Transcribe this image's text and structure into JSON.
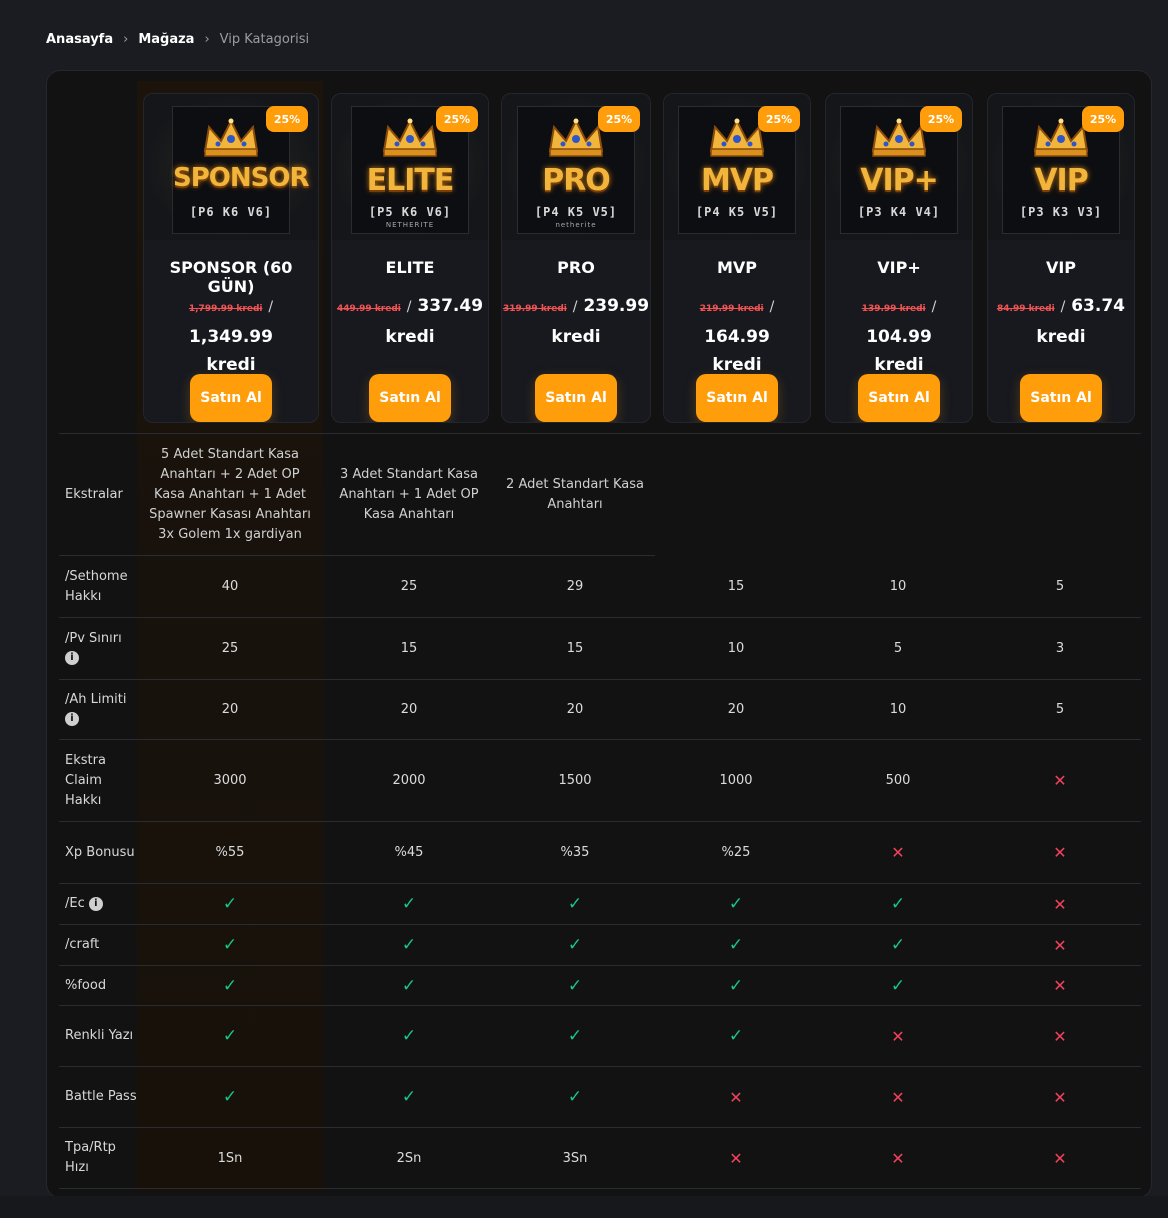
{
  "breadcrumb": [
    "Anasayfa",
    "Mağaza",
    "Vip Katagorisi"
  ],
  "colors": {
    "accent": "#ff9d0a",
    "check": "#17c78a",
    "cross": "#f0425b",
    "old_price": "#f25353"
  },
  "plans": [
    {
      "name": "SPONSOR (60 GÜN)",
      "logo": "SPONSOR",
      "logo_sub": "[P6 K6 V6]",
      "logo_tag": "",
      "badge": "25%",
      "old_price": "1,799.99 kredi",
      "price": "1,349.99",
      "currency": "kredi",
      "buy_label": "Satın Al"
    },
    {
      "name": "ELITE",
      "logo": "ELITE",
      "logo_sub": "[P5 K6 V6]",
      "logo_tag": "NETHERITE",
      "badge": "25%",
      "old_price": "449.99 kredi",
      "price": "337.49",
      "currency": "kredi",
      "buy_label": "Satın Al"
    },
    {
      "name": "PRO",
      "logo": "PRO",
      "logo_sub": "[P4 K5 V5]",
      "logo_tag": "netherite",
      "badge": "25%",
      "old_price": "319.99 kredi",
      "price": "239.99",
      "currency": "kredi",
      "buy_label": "Satın Al"
    },
    {
      "name": "MVP",
      "logo": "MVP",
      "logo_sub": "[P4 K5 V5]",
      "logo_tag": "",
      "badge": "25%",
      "old_price": "219.99 kredi",
      "price": "164.99",
      "currency": "kredi",
      "buy_label": "Satın Al"
    },
    {
      "name": "VIP+",
      "logo": "VIP+",
      "logo_sub": "[P3 K4 V4]",
      "logo_tag": "",
      "badge": "25%",
      "old_price": "139.99 kredi",
      "price": "104.99",
      "currency": "kredi",
      "buy_label": "Satın Al"
    },
    {
      "name": "VIP",
      "logo": "VIP",
      "logo_sub": "[P3 K3 V3]",
      "logo_tag": "",
      "badge": "25%",
      "old_price": "84.99 kredi",
      "price": "63.74",
      "currency": "kredi",
      "buy_label": "Satın Al"
    }
  ],
  "extras": {
    "label": "Ekstralar",
    "values": [
      "5 Adet Standart Kasa Anahtarı + 2 Adet OP Kasa Anahtarı + 1 Adet Spawner Kasası Anahtarı 3x Golem 1x gardiyan",
      "3 Adet Standart Kasa Anahtarı + 1 Adet OP Kasa Anahtarı",
      "2 Adet Standart Kasa Anahtarı"
    ]
  },
  "features": [
    {
      "label": "/Sethome Hakkı",
      "info": false,
      "values": [
        "40",
        "25",
        "29",
        "15",
        "10",
        "5"
      ]
    },
    {
      "label": "/Pv Sınırı",
      "info": true,
      "values": [
        "25",
        "15",
        "15",
        "10",
        "5",
        "3"
      ]
    },
    {
      "label": "/Ah Limiti",
      "info": true,
      "values": [
        "20",
        "20",
        "20",
        "20",
        "10",
        "5"
      ]
    },
    {
      "label": "Ekstra Claim Hakkı",
      "info": false,
      "values": [
        "3000",
        "2000",
        "1500",
        "1000",
        "500",
        "x"
      ]
    },
    {
      "label": "Xp Bonusu",
      "info": false,
      "values": [
        "%55",
        "%45",
        "%35",
        "%25",
        "x",
        "x"
      ]
    },
    {
      "label": "/Ec",
      "info": true,
      "values": [
        "check",
        "check",
        "check",
        "check",
        "check",
        "x"
      ]
    },
    {
      "label": "/craft",
      "info": false,
      "values": [
        "check",
        "check",
        "check",
        "check",
        "check",
        "x"
      ]
    },
    {
      "label": "%food",
      "info": false,
      "values": [
        "check",
        "check",
        "check",
        "check",
        "check",
        "x"
      ]
    },
    {
      "label": "Renkli Yazı",
      "info": false,
      "values": [
        "check",
        "check",
        "check",
        "check",
        "x",
        "x"
      ]
    },
    {
      "label": "Battle Pass",
      "info": false,
      "values": [
        "check",
        "check",
        "check",
        "x",
        "x",
        "x"
      ]
    },
    {
      "label": "Tpa/Rtp Hızı",
      "info": false,
      "values": [
        "1Sn",
        "2Sn",
        "3Sn",
        "x",
        "x",
        "x"
      ]
    }
  ]
}
